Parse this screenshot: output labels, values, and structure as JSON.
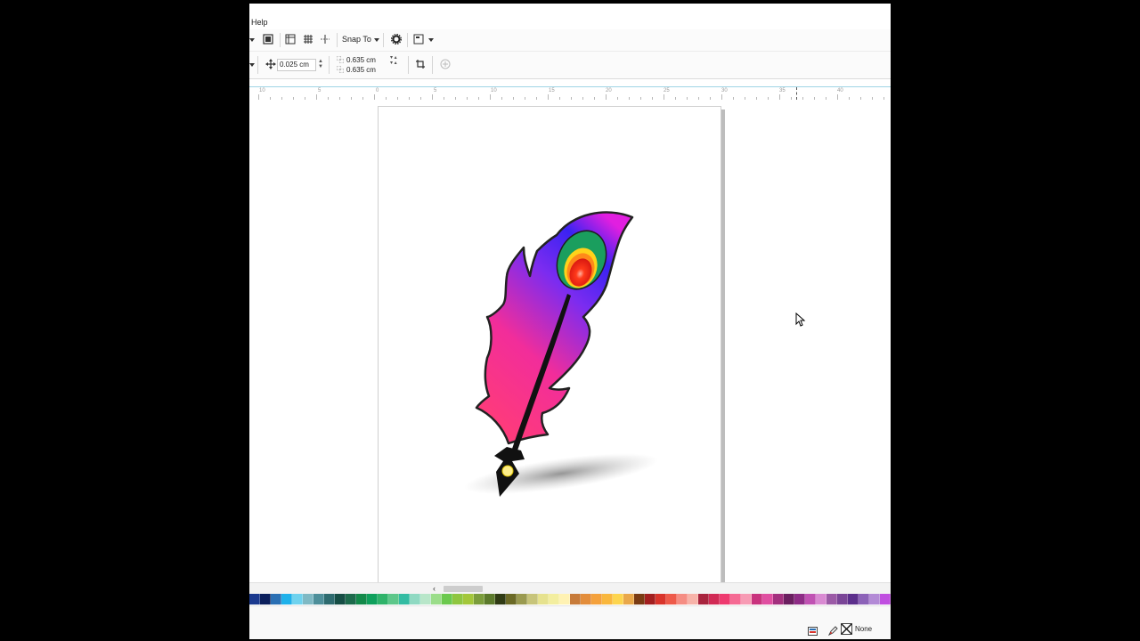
{
  "menubar": {
    "help_label": "Help"
  },
  "toolbar": {
    "snap_label": "Snap To"
  },
  "propbar": {
    "nudge_value": "0.025 cm",
    "dup_x_value": "0.635 cm",
    "dup_y_value": "0.635 cm"
  },
  "ruler": {
    "labels": [
      "10",
      "5",
      "0",
      "5",
      "10",
      "15",
      "20",
      "25",
      "30",
      "35",
      "40"
    ]
  },
  "statusbar": {
    "outline_label": "None"
  },
  "palette": [
    "#1b3a8f",
    "#0b1f5c",
    "#2a6fb3",
    "#1fb1ea",
    "#6fd2ee",
    "#7fb9c4",
    "#4e8f9a",
    "#2e6b6f",
    "#164e45",
    "#1d6b4c",
    "#138a4a",
    "#0fa05c",
    "#2fb36a",
    "#5dc78a",
    "#33bca3",
    "#8fd9c2",
    "#b8e6c9",
    "#9bdd8a",
    "#6cc94e",
    "#8fc640",
    "#a3c73a",
    "#7b9d3b",
    "#5c7a2b",
    "#303b14",
    "#6b6a26",
    "#9a9a50",
    "#c7c47a",
    "#e6e28e",
    "#f3ee9f",
    "#fff2b3",
    "#c77b3a",
    "#e38d3b",
    "#f4a13c",
    "#f9b73d",
    "#fdd54f",
    "#e9a84a",
    "#7a3b13",
    "#a31f1f",
    "#d9342b",
    "#ee5a4a",
    "#f58d83",
    "#f7b3a9",
    "#a8243e",
    "#d12a55",
    "#ee3a6f",
    "#f56a93",
    "#f79bb4",
    "#c9337e",
    "#e04fa1",
    "#a3307e",
    "#6b1f60",
    "#8e2c86",
    "#c052b3",
    "#d98ad2",
    "#9b5aa6",
    "#7a4597",
    "#5c2f8c",
    "#8c62b8",
    "#b38ad6",
    "#c04fe0"
  ]
}
